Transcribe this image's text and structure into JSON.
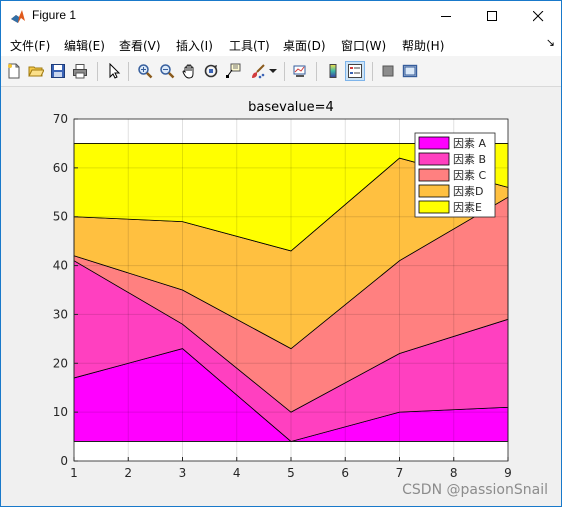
{
  "window": {
    "title": "Figure 1"
  },
  "menu": {
    "items": [
      "文件(F)",
      "编辑(E)",
      "查看(V)",
      "插入(I)",
      "工具(T)",
      "桌面(D)",
      "窗口(W)",
      "帮助(H)"
    ]
  },
  "toolbar": {
    "icons": [
      "new-figure-icon",
      "open-file-icon",
      "save-icon",
      "print-icon",
      "pointer-icon",
      "zoom-in-icon",
      "zoom-out-icon",
      "pan-icon",
      "rotate-3d-icon",
      "data-cursor-icon",
      "brush-icon",
      "brush-dropdown-icon",
      "link-plot-icon",
      "colorbar-icon",
      "legend-icon",
      "hide-plot-tools-icon",
      "show-plot-tools-icon"
    ]
  },
  "chart_data": {
    "type": "area",
    "title": "basevalue=4",
    "x": [
      1,
      3,
      5,
      7,
      9
    ],
    "base_value": 4,
    "xlim": [
      1,
      9
    ],
    "ylim": [
      0,
      70
    ],
    "xticks": [
      1,
      2,
      3,
      4,
      5,
      6,
      7,
      8,
      9
    ],
    "yticks": [
      0,
      10,
      20,
      30,
      40,
      50,
      60,
      70
    ],
    "grid": true,
    "legend_position": "top-right",
    "series": [
      {
        "name": "因素 A",
        "values": [
          17,
          23,
          4,
          10,
          11
        ],
        "color": "#ff00ff"
      },
      {
        "name": "因素 B",
        "values": [
          24,
          5,
          6,
          12,
          18
        ],
        "color": "#ff40c0"
      },
      {
        "name": "因素 C",
        "values": [
          1,
          7,
          13,
          19,
          25
        ],
        "color": "#ff8080"
      },
      {
        "name": "因素D",
        "values": [
          8,
          14,
          20,
          21,
          2
        ],
        "color": "#ffc040"
      },
      {
        "name": "因素E",
        "values": [
          15,
          16,
          22,
          3,
          9
        ],
        "color": "#ffff00"
      }
    ]
  },
  "watermark": "CSDN @passionSnail"
}
